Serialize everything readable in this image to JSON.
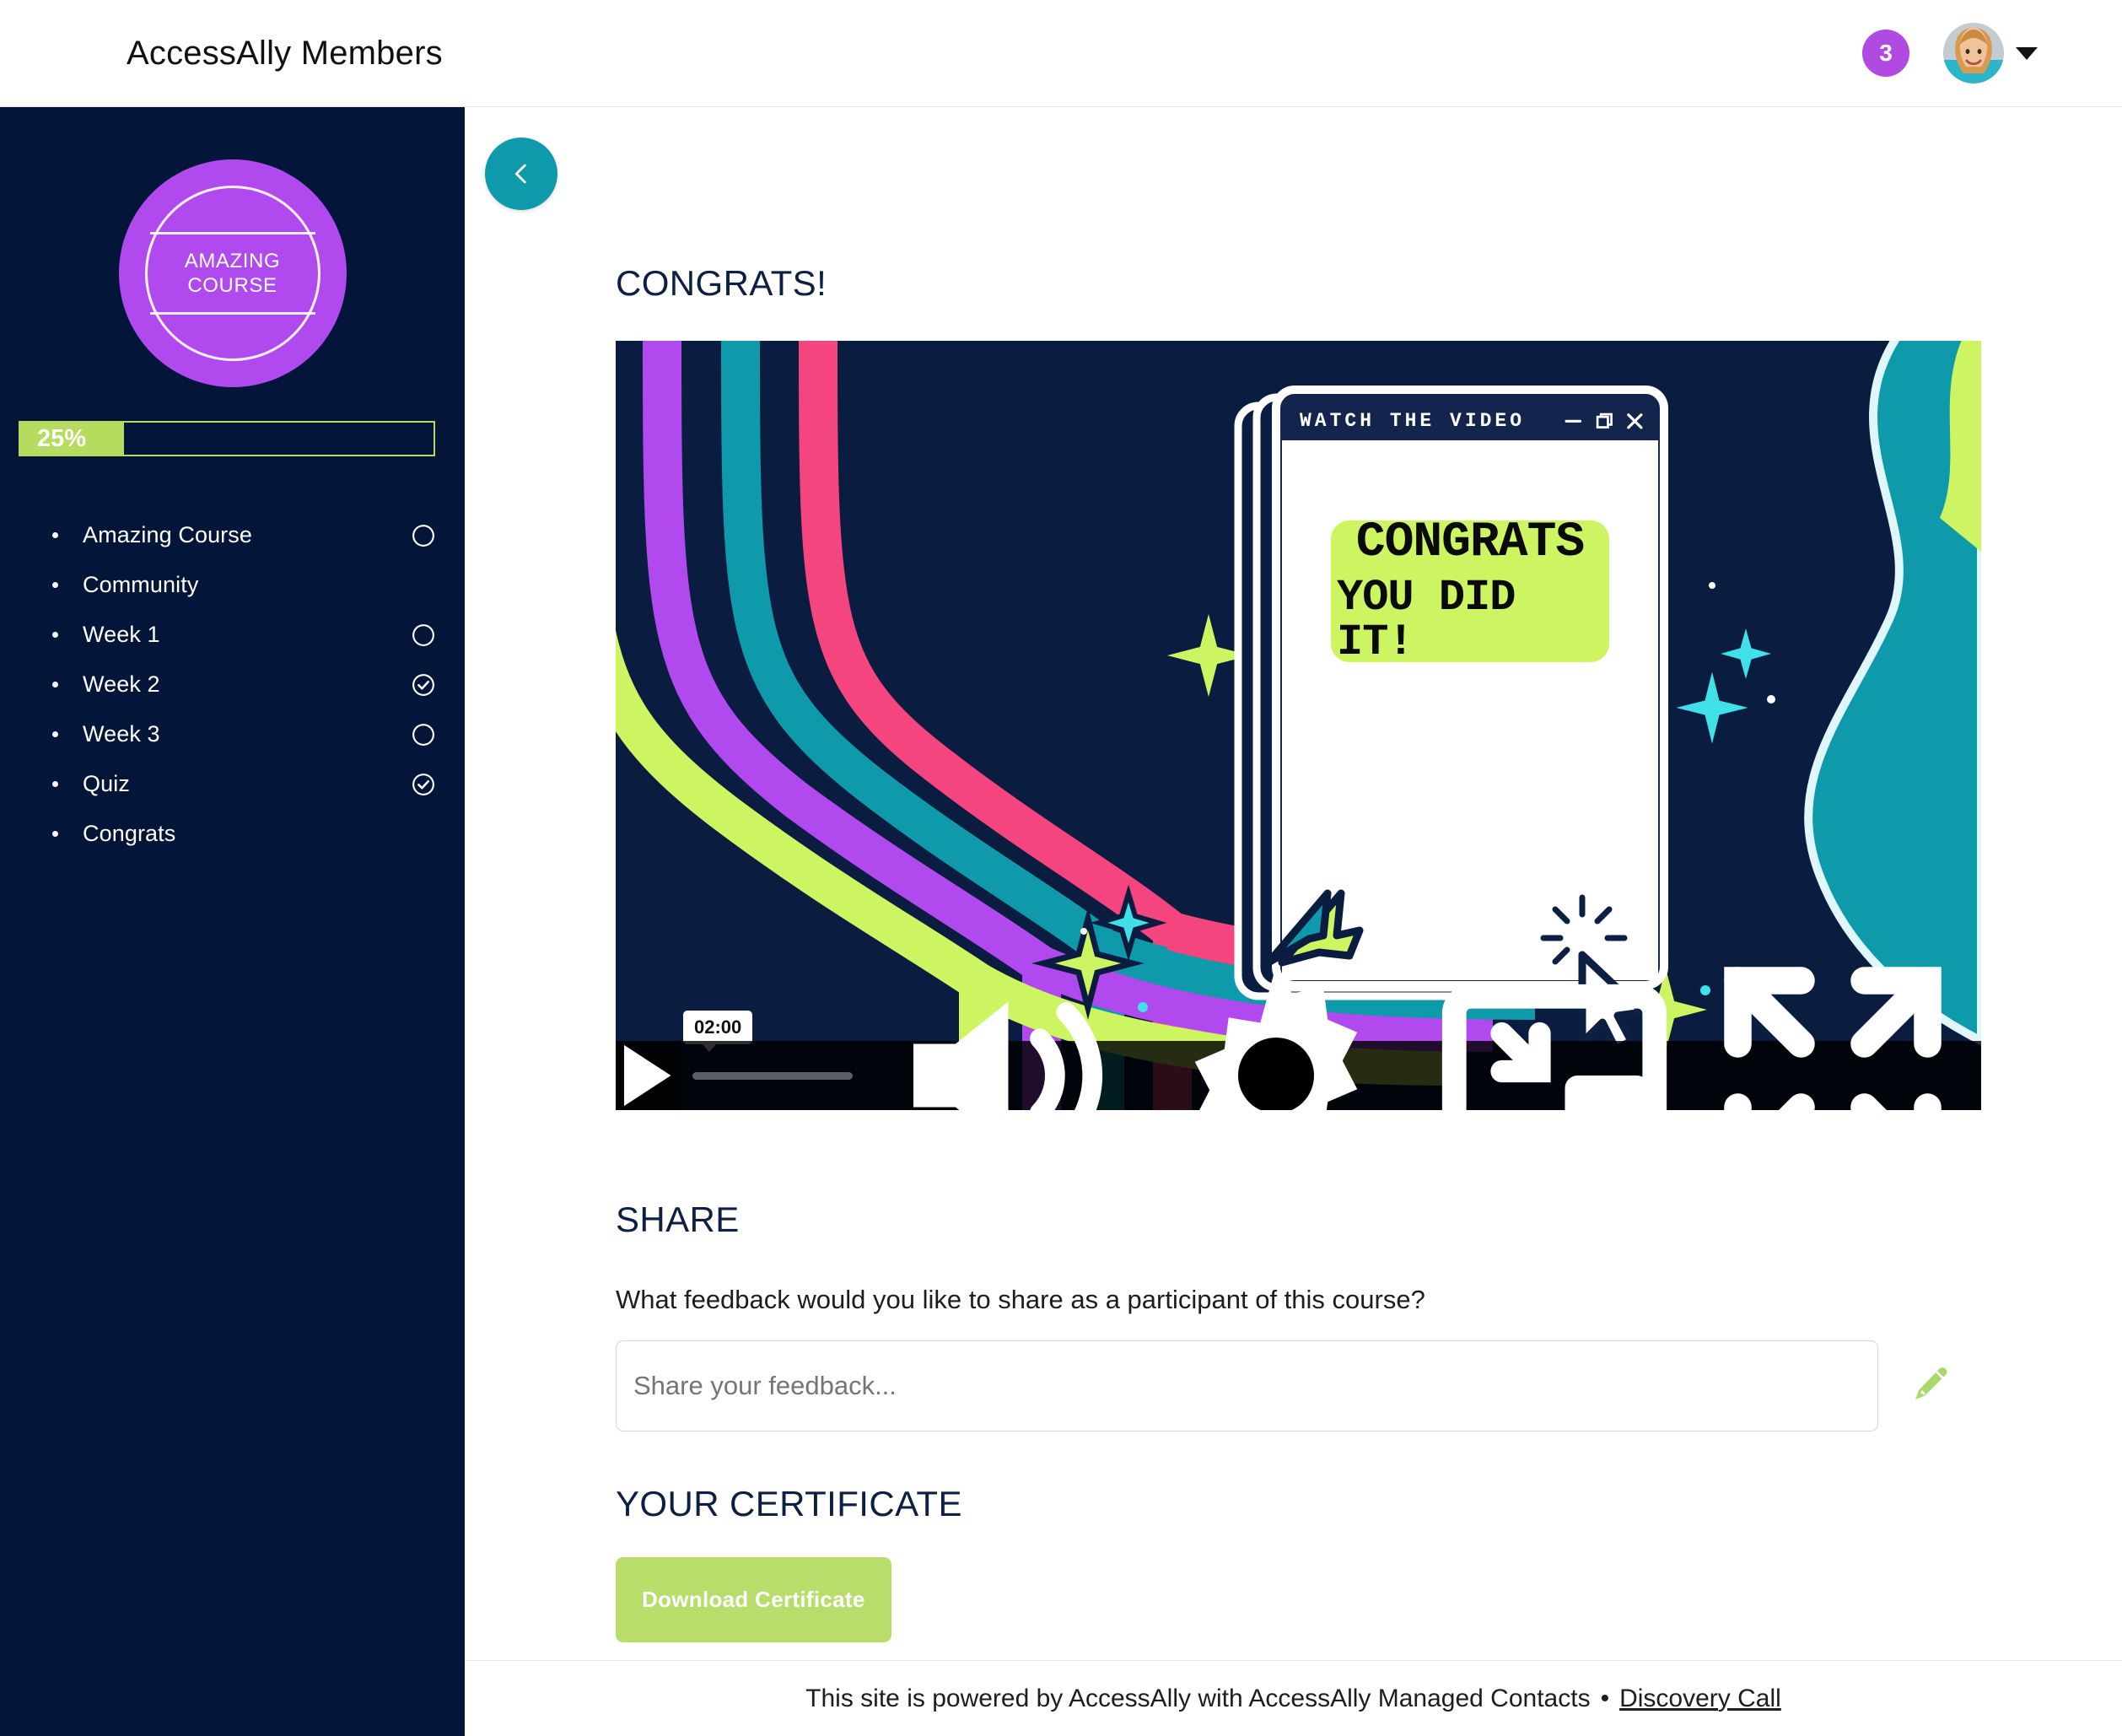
{
  "header": {
    "site_title": "AccessAlly Members",
    "notification_count": "3",
    "badge_color": "#b04ae0"
  },
  "sidebar": {
    "badge": {
      "line1": "AMAZING",
      "line2": "COURSE",
      "color": "#b14aee"
    },
    "progress": {
      "percent_label": "25%",
      "percent_value": 25,
      "fill_color": "#b5db5f"
    },
    "items": [
      {
        "label": "Amazing Course",
        "status": "incomplete"
      },
      {
        "label": "Community",
        "status": "none"
      },
      {
        "label": "Week 1",
        "status": "incomplete"
      },
      {
        "label": "Week 2",
        "status": "complete"
      },
      {
        "label": "Week 3",
        "status": "incomplete"
      },
      {
        "label": "Quiz",
        "status": "complete"
      },
      {
        "label": "Congrats",
        "status": "none"
      }
    ]
  },
  "main": {
    "back_button_color": "#0e9aaa",
    "page_title": "CONGRATS!",
    "video": {
      "window_title": "WATCH THE VIDEO",
      "headline_line1": "CONGRATS",
      "headline_line2": "YOU DID IT!",
      "time_tooltip": "02:00",
      "progress_value": 0
    },
    "share": {
      "heading": "SHARE",
      "question": "What feedback would you like to share as a participant of this course?",
      "input_value": "",
      "input_placeholder": "Share your feedback..."
    },
    "certificate": {
      "heading": "YOUR CERTIFICATE",
      "button_label": "Download Certificate",
      "button_color": "#b8dd6a"
    }
  },
  "footer": {
    "text": "This site is powered by AccessAlly with AccessAlly Managed Contacts",
    "separator": "•",
    "link_label": "Discovery Call"
  }
}
